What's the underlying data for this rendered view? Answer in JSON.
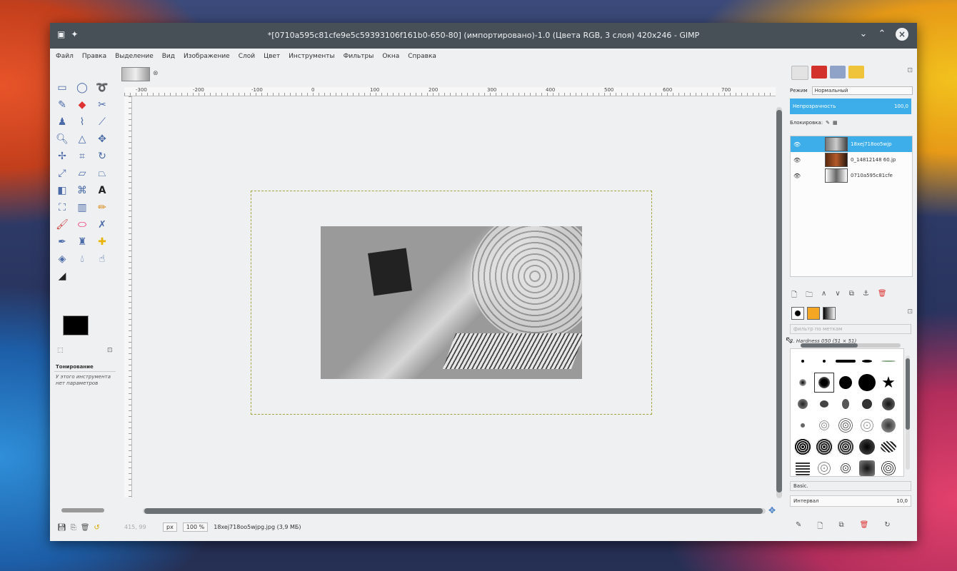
{
  "window": {
    "title": "*[0710a595c81cfe9e5c59393106f161b0-650-80] (импортировано)-1.0 (Цвета RGB, 3 слоя) 420x246 - GIMP",
    "controls": {
      "minimize": "⌄",
      "maximize": "⌃",
      "close": "×"
    }
  },
  "menu": [
    "Файл",
    "Правка",
    "Выделение",
    "Вид",
    "Изображение",
    "Слой",
    "Цвет",
    "Инструменты",
    "Фильтры",
    "Окна",
    "Справка"
  ],
  "toolbox": {
    "tool_options_title": "Тонирование",
    "tool_options_desc": "У этого инструмента нет параметров"
  },
  "ruler": {
    "h_marks": [
      "-300",
      "-200",
      "-100",
      "0",
      "100",
      "200",
      "300",
      "400",
      "500",
      "600",
      "700"
    ]
  },
  "status": {
    "coords": "415, 99",
    "unit": "px",
    "zoom": "100 %",
    "file_info": "18xej718oo5wjpg.jpg (3,9 МБ)"
  },
  "layers_panel": {
    "mode_label": "Режим",
    "mode_value": "Нормальный",
    "opacity_label": "Непрозрачность",
    "opacity_value": "100,0",
    "lock_label": "Блокировка:",
    "layers": [
      {
        "name": "18xej718oo5wjp",
        "active": true
      },
      {
        "name": "0_14812148 60.jp",
        "active": false
      },
      {
        "name": "0710a595c81cfe",
        "active": false
      }
    ]
  },
  "brushes_panel": {
    "filter_placeholder": "фильтр по меткам",
    "current_brush": "2. Hardness 050 (51 × 51)",
    "preset": "Basic.",
    "spacing_label": "Интервал",
    "spacing_value": "10,0"
  },
  "colors": {
    "accent": "#3daee9",
    "titlebar": "#475057",
    "foreground": "#000000",
    "background": "#ffffff"
  }
}
